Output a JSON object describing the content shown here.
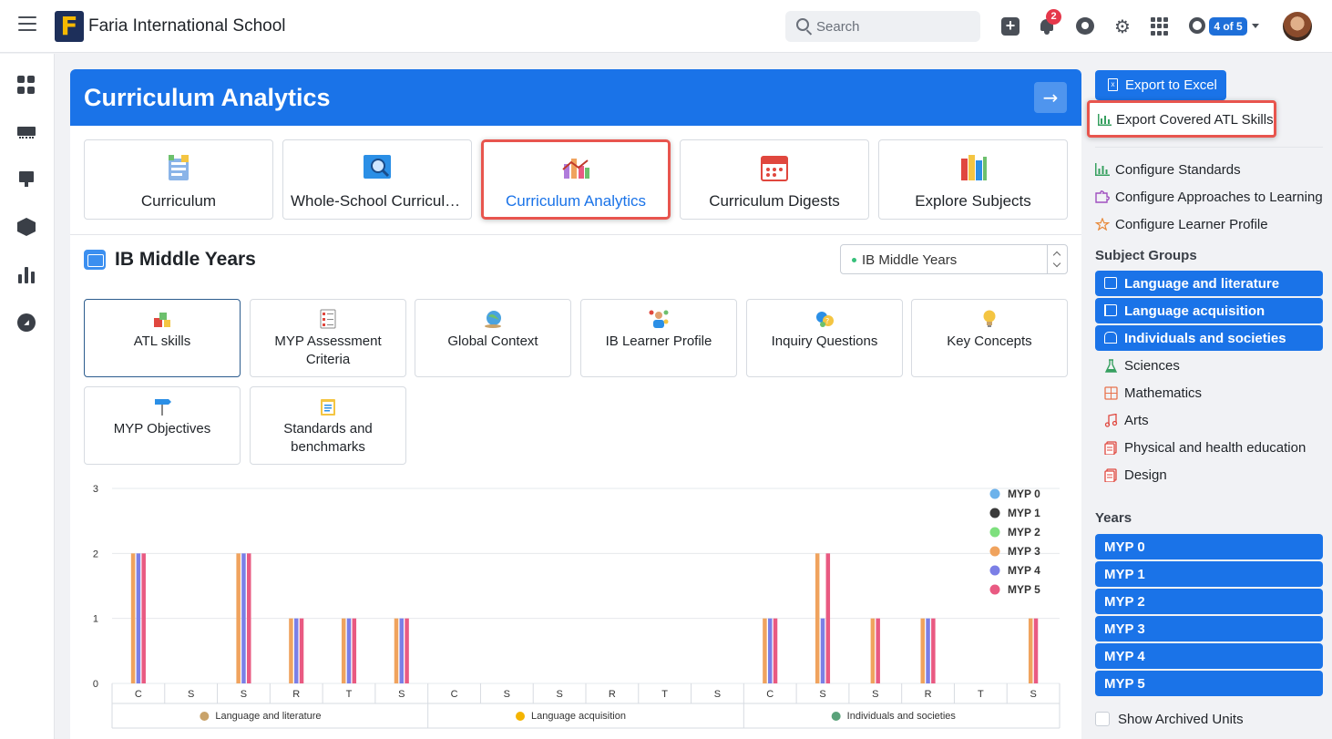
{
  "header": {
    "school_name": "Faria International School",
    "logo_letter": "F",
    "search_placeholder": "Search",
    "notifications_count": "2",
    "school_switcher": "4 of 5"
  },
  "sidebar": {
    "icons": [
      "dashboard-icon",
      "classes-icon",
      "teaching-icon",
      "curriculum-box-icon",
      "analytics-icon",
      "explore-compass-icon"
    ]
  },
  "page": {
    "title": "Curriculum Analytics",
    "nav_tiles": [
      {
        "label": "Curriculum",
        "icon": "curriculum-icon"
      },
      {
        "label": "Whole-School Curriculu...",
        "icon": "whole-school-icon"
      },
      {
        "label": "Curriculum Analytics",
        "icon": "analytics-chart-icon",
        "active": true
      },
      {
        "label": "Curriculum Digests",
        "icon": "calendar-icon"
      },
      {
        "label": "Explore Subjects",
        "icon": "books-icon"
      }
    ],
    "program": {
      "title": "IB Middle Years",
      "select_value": "IB Middle Years"
    },
    "categories": [
      {
        "label": "ATL skills",
        "selected": true
      },
      {
        "label": "MYP Assessment Criteria"
      },
      {
        "label": "Global Context"
      },
      {
        "label": "IB Learner Profile"
      },
      {
        "label": "Inquiry Questions"
      },
      {
        "label": "Key Concepts"
      },
      {
        "label": "MYP Objectives"
      },
      {
        "label": "Standards and benchmarks"
      }
    ]
  },
  "chart_data": {
    "type": "bar",
    "ylim": [
      0,
      3
    ],
    "yticks": [
      0,
      1,
      2,
      3
    ],
    "legend_position": "top-right",
    "categories": [
      "C",
      "S",
      "S",
      "R",
      "T",
      "S",
      "C",
      "S",
      "S",
      "R",
      "T",
      "S",
      "C",
      "S",
      "S",
      "R",
      "T",
      "S"
    ],
    "groups": [
      {
        "label": "Language and literature",
        "span": [
          0,
          5
        ]
      },
      {
        "label": "Language acquisition",
        "span": [
          6,
          11
        ]
      },
      {
        "label": "Individuals and societies",
        "span": [
          12,
          17
        ]
      }
    ],
    "series": [
      {
        "name": "MYP 0",
        "color": "#6cb2eb",
        "values": [
          0,
          0,
          0,
          0,
          0,
          0,
          0,
          0,
          0,
          0,
          0,
          0,
          0,
          0,
          0,
          0,
          0,
          0
        ]
      },
      {
        "name": "MYP 1",
        "color": "#3a3a3a",
        "values": [
          0,
          0,
          0,
          0,
          0,
          0,
          0,
          0,
          0,
          0,
          0,
          0,
          0,
          0,
          0,
          0,
          0,
          0
        ]
      },
      {
        "name": "MYP 2",
        "color": "#7ee07e",
        "values": [
          0,
          0,
          0,
          0,
          0,
          0,
          0,
          0,
          0,
          0,
          0,
          0,
          0,
          0,
          0,
          0,
          0,
          0
        ]
      },
      {
        "name": "MYP 3",
        "color": "#f0a35e",
        "values": [
          2,
          0,
          2,
          1,
          1,
          1,
          0,
          0,
          0,
          0,
          0,
          0,
          1,
          2,
          1,
          1,
          0,
          1
        ]
      },
      {
        "name": "MYP 4",
        "color": "#7b7fe6",
        "values": [
          2,
          0,
          2,
          1,
          1,
          1,
          0,
          0,
          0,
          0,
          0,
          0,
          1,
          1,
          0,
          1,
          0,
          0
        ]
      },
      {
        "name": "MYP 5",
        "color": "#e95a82",
        "values": [
          2,
          0,
          2,
          1,
          1,
          1,
          0,
          0,
          0,
          0,
          0,
          0,
          1,
          2,
          1,
          1,
          0,
          1
        ]
      }
    ]
  },
  "right_panel": {
    "export_excel": "Export to Excel",
    "export_atl": "Export Covered ATL Skills",
    "configure": [
      {
        "label": "Configure Standards",
        "icon": "standards-chart-icon"
      },
      {
        "label": "Configure Approaches to Learning",
        "icon": "puzzle-icon"
      },
      {
        "label": "Configure Learner Profile",
        "icon": "star-icon"
      }
    ],
    "subject_groups_heading": "Subject Groups",
    "subject_groups": [
      {
        "label": "Language and literature",
        "selected": true,
        "icon": "book-icon"
      },
      {
        "label": "Language acquisition",
        "selected": true,
        "icon": "flag-icon"
      },
      {
        "label": "Individuals and societies",
        "selected": true,
        "icon": "building-icon"
      },
      {
        "label": "Sciences",
        "selected": false,
        "icon": "flask-icon"
      },
      {
        "label": "Mathematics",
        "selected": false,
        "icon": "calculator-icon"
      },
      {
        "label": "Arts",
        "selected": false,
        "icon": "music-icon"
      },
      {
        "label": "Physical and health education",
        "selected": false,
        "icon": "document-icon"
      },
      {
        "label": "Design",
        "selected": false,
        "icon": "design-document-icon"
      }
    ],
    "years_heading": "Years",
    "years": [
      "MYP 0",
      "MYP 1",
      "MYP 2",
      "MYP 3",
      "MYP 4",
      "MYP 5"
    ],
    "show_archived": "Show Archived Units"
  }
}
